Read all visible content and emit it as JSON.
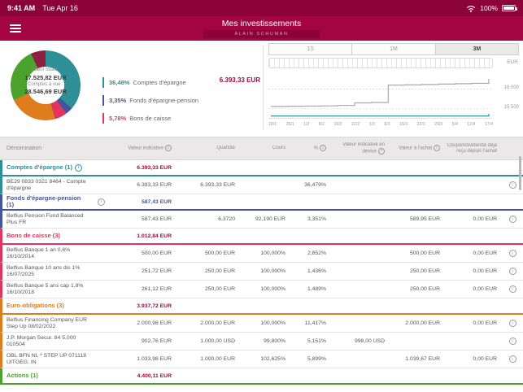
{
  "status_bar": {
    "time": "9:41 AM",
    "date": "Tue Apr 16",
    "battery_pct": "100%"
  },
  "header": {
    "title": "Mes investissements",
    "subtitle": "ALAIN SCHUMAN"
  },
  "summary": {
    "total_label": "Valeur totale :",
    "total_value": "17.525,82 EUR",
    "sight_label": "Comptes à vue :",
    "sight_value": "28.546,69 EUR",
    "selected_value": "6.393,33 EUR",
    "legend": [
      {
        "pct": "36,48%",
        "label": "Comptes d'épargne",
        "color": "#2E8F96"
      },
      {
        "pct": "3,35%",
        "label": "Fonds d'épargne-pension",
        "color": "#44559E"
      },
      {
        "pct": "5,78%",
        "label": "Bons de caisse",
        "color": "#E0355F"
      }
    ],
    "donut_segments": [
      {
        "label": "Comptes d'épargne",
        "pct": 36.48,
        "color": "#2E8F96"
      },
      {
        "label": "Fonds d'épargne-pension",
        "pct": 3.35,
        "color": "#44559E"
      },
      {
        "label": "Bons de caisse",
        "pct": 5.78,
        "color": "#E0355F"
      },
      {
        "label": "Euro-obligations",
        "pct": 22.47,
        "color": "#DE7C1E"
      },
      {
        "label": "Actions",
        "pct": 25.11,
        "color": "#4BA32E"
      },
      {
        "label": "",
        "pct": 6.81,
        "color": "#8E1F3F"
      }
    ]
  },
  "range_tabs": [
    {
      "label": "1S",
      "selected": false
    },
    {
      "label": "1M",
      "selected": false
    },
    {
      "label": "3M",
      "selected": true
    }
  ],
  "chart_data": {
    "type": "line",
    "x": [
      "18/1",
      "25/1",
      "1/2",
      "8/2",
      "15/2",
      "22/2",
      "1/3",
      "8/3",
      "15/3",
      "22/3",
      "29/3",
      "5/4",
      "12/4",
      "17/4"
    ],
    "series": [
      {
        "name": "Valeur totale",
        "color": "#A9A9A9",
        "values": [
          15560,
          15565,
          15570,
          15575,
          15585,
          15650,
          15660,
          16100,
          16105,
          16115,
          16125,
          16135,
          16145,
          16260
        ]
      },
      {
        "name": "Comptes d'épargne",
        "color": "#2E8F96",
        "values": [
          15320,
          15320,
          15320,
          15320,
          15320,
          15320,
          15320,
          15320,
          15320,
          15320,
          15320,
          15320,
          15320,
          15370
        ]
      }
    ],
    "ylabel": "EUR",
    "yticks": [
      {
        "label": "16 000",
        "value": 16000
      },
      {
        "label": "15 500",
        "value": 15500
      }
    ],
    "ylim": [
      15250,
      16400
    ],
    "grid": true,
    "legend_position": "none"
  },
  "table": {
    "columns": [
      {
        "label": "Dénomination",
        "info": false
      },
      {
        "label": "Valeur indicative",
        "info": true
      },
      {
        "label": "Quantité",
        "info": false
      },
      {
        "label": "Cours",
        "info": false
      },
      {
        "label": "%",
        "info": true
      },
      {
        "label": "Valeur indicative en devise",
        "info": true
      },
      {
        "label": "Valeur à l'achat",
        "info": true
      },
      {
        "label": "Coupon/dividende déjà reçu depuis l'achat",
        "info": false
      },
      {
        "label": "",
        "info": false
      }
    ],
    "groups": [
      {
        "label": "Comptes d'épargne (1)",
        "color": "#2E8F96",
        "value": "6.393,33 EUR",
        "value_color": "#A2053F",
        "info": "inline",
        "rows": [
          {
            "name": "BE29 0833 0321 8464 - Compte d'épargne",
            "valeur": "6.393,33 EUR",
            "quantite": "6.393,33 EUR",
            "cours": "",
            "pct": "36,479%",
            "devise": "",
            "achat": "",
            "coupon": ""
          }
        ]
      },
      {
        "label": "Fonds d'épargne-pension (1)",
        "color": "#44559E",
        "value": "587,43 EUR",
        "value_color": "#44559E",
        "info": "right",
        "rows": [
          {
            "name": "Belfius Pension Fund Balanced Plus FR",
            "valeur": "587,43 EUR",
            "quantite": "6,3720",
            "cours": "92,190 EUR",
            "pct": "3,351%",
            "devise": "",
            "achat": "589,95 EUR",
            "coupon": "0,00 EUR"
          }
        ]
      },
      {
        "label": "Bons de caisse (3)",
        "color": "#E0355F",
        "value": "1.012,84 EUR",
        "value_color": "#A2053F",
        "info": null,
        "rows": [
          {
            "name": "Belfius Banque 1 an 0,6% 16/10/2014",
            "valeur": "500,00 EUR",
            "quantite": "500,00 EUR",
            "cours": "100,000%",
            "pct": "2,852%",
            "devise": "",
            "achat": "500,00 EUR",
            "coupon": "0,00 EUR"
          },
          {
            "name": "Belfius Banque 10 ans dis 1% 16/07/2025",
            "valeur": "251,72 EUR",
            "quantite": "250,00 EUR",
            "cours": "100,000%",
            "pct": "1,436%",
            "devise": "",
            "achat": "250,00 EUR",
            "coupon": "0,00 EUR"
          },
          {
            "name": "Belfius Banque 5 ans cap 1,8% 16/10/2018",
            "valeur": "261,12 EUR",
            "quantite": "250,00 EUR",
            "cours": "100,000%",
            "pct": "1,489%",
            "devise": "",
            "achat": "250,00 EUR",
            "coupon": "0,00 EUR"
          }
        ]
      },
      {
        "label": "Euro-obligations (3)",
        "color": "#DE7C1E",
        "value": "3.937,72 EUR",
        "value_color": "#A2053F",
        "info": null,
        "rows": [
          {
            "name": "Belfius Financing Company EUR Step Up 08/02/2022",
            "valeur": "2.000,98 EUR",
            "quantite": "2.000,00 EUR",
            "cours": "100,000%",
            "pct": "11,417%",
            "devise": "",
            "achat": "2.000,00 EUR",
            "coupon": "0,00 EUR"
          },
          {
            "name": "J.P. Morgan Secur. 84 5,000 010504",
            "valeur": "902,76 EUR",
            "quantite": "1.000,00 USD",
            "cours": "99,800%",
            "pct": "5,151%",
            "devise": "998,00 USD",
            "achat": "",
            "coupon": ""
          },
          {
            "name": "OBL BFN NL * STEP UP 071118 UITGEG. IN",
            "valeur": "1.033,98 EUR",
            "quantite": "1.000,00 EUR",
            "cours": "102,625%",
            "pct": "5,899%",
            "devise": "",
            "achat": "1.039,67 EUR",
            "coupon": "0,00 EUR"
          }
        ]
      },
      {
        "label": "Actions (1)",
        "color": "#4BA32E",
        "value": "4.400,11 EUR",
        "value_color": "#A2053F",
        "info": null,
        "rows": []
      }
    ]
  },
  "colors": {
    "brand": "#A2053F",
    "status_bar": "#8C0337"
  }
}
